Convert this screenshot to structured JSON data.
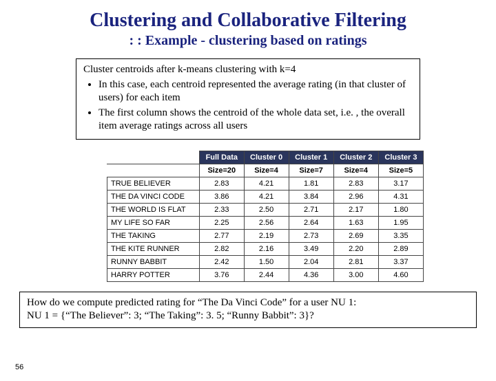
{
  "title": "Clustering and Collaborative Filtering",
  "subtitle": ": : Example - clustering based on ratings",
  "box": {
    "lead": "Cluster centroids after k-means clustering with k=4",
    "b1": "In this case, each centroid represented the average rating (in that cluster of users) for each item",
    "b2": "The first column shows the centroid of the whole data set, i.e. , the overall item average ratings across all users"
  },
  "headers": {
    "c0": "Full Data",
    "c1": "Cluster 0",
    "c2": "Cluster 1",
    "c3": "Cluster 2",
    "c4": "Cluster 3"
  },
  "sizes": {
    "c0": "Size=20",
    "c1": "Size=4",
    "c2": "Size=7",
    "c3": "Size=4",
    "c4": "Size=5"
  },
  "rows": {
    "r0": {
      "label": "TRUE BELIEVER",
      "v0": "2.83",
      "v1": "4.21",
      "v2": "1.81",
      "v3": "2.83",
      "v4": "3.17"
    },
    "r1": {
      "label": "THE DA VINCI CODE",
      "v0": "3.86",
      "v1": "4.21",
      "v2": "3.84",
      "v3": "2.96",
      "v4": "4.31"
    },
    "r2": {
      "label": "THE WORLD IS FLAT",
      "v0": "2.33",
      "v1": "2.50",
      "v2": "2.71",
      "v3": "2.17",
      "v4": "1.80"
    },
    "r3": {
      "label": "MY LIFE SO FAR",
      "v0": "2.25",
      "v1": "2.56",
      "v2": "2.64",
      "v3": "1.63",
      "v4": "1.95"
    },
    "r4": {
      "label": "THE TAKING",
      "v0": "2.77",
      "v1": "2.19",
      "v2": "2.73",
      "v3": "2.69",
      "v4": "3.35"
    },
    "r5": {
      "label": "THE KITE RUNNER",
      "v0": "2.82",
      "v1": "2.16",
      "v2": "3.49",
      "v3": "2.20",
      "v4": "2.89"
    },
    "r6": {
      "label": "RUNNY BABBIT",
      "v0": "2.42",
      "v1": "1.50",
      "v2": "2.04",
      "v3": "2.81",
      "v4": "3.37"
    },
    "r7": {
      "label": "HARRY POTTER",
      "v0": "3.76",
      "v1": "2.44",
      "v2": "4.36",
      "v3": "3.00",
      "v4": "4.60"
    }
  },
  "question": {
    "l1": "How do we compute predicted rating for “The Da Vinci Code” for a user NU 1:",
    "l2": "NU 1 = {“The Believer”: 3; “The Taking”: 3. 5; “Runny Babbit”: 3}?"
  },
  "pagenum": "56"
}
